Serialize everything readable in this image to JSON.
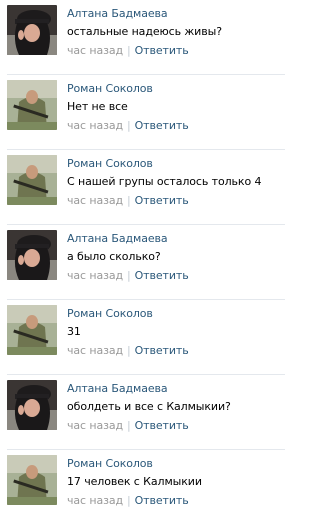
{
  "comments": [
    {
      "author": "Алтана Бадмаева",
      "text": "остальные надеюсь живы?",
      "time": "час назад",
      "reply": "Ответить",
      "avatar": "girl-avatar"
    },
    {
      "author": "Роман Соколов",
      "text": "Нет не все",
      "time": "час назад",
      "reply": "Ответить",
      "avatar": "soldier-avatar"
    },
    {
      "author": "Роман Соколов",
      "text": "С нашей групы осталось только 4",
      "time": "час назад",
      "reply": "Ответить",
      "avatar": "soldier-avatar"
    },
    {
      "author": "Алтана Бадмаева",
      "text": "а было сколько?",
      "time": "час назад",
      "reply": "Ответить",
      "avatar": "girl-avatar"
    },
    {
      "author": "Роман Соколов",
      "text": "31",
      "time": "час назад",
      "reply": "Ответить",
      "avatar": "soldier-avatar"
    },
    {
      "author": "Алтана Бадмаева",
      "text": "оболдеть и все с Калмыкии?",
      "time": "час назад",
      "reply": "Ответить",
      "avatar": "girl-avatar"
    },
    {
      "author": "Роман Соколов",
      "text": "17 человек с Калмыкии",
      "time": "час назад",
      "reply": "Ответить",
      "avatar": "soldier-avatar"
    }
  ],
  "colors": {
    "link": "#2b587a",
    "time": "#999999",
    "separator": "#e4e8ed"
  }
}
